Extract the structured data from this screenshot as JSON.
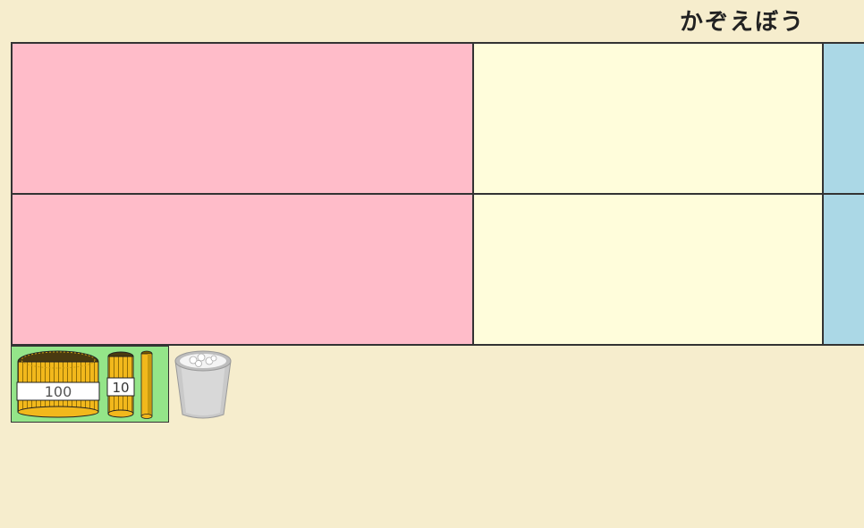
{
  "header": {
    "title": "かぞえぼう"
  },
  "board": {
    "rows": [
      {
        "columns": [
          "hundreds",
          "tens",
          "ones"
        ]
      },
      {
        "columns": [
          "hundreds",
          "tens",
          "ones"
        ]
      }
    ],
    "colors": {
      "hundreds": "#ffbcc9",
      "tens": "#fffddb",
      "ones": "#abd8e6"
    }
  },
  "toolbar": {
    "tools": [
      {
        "icon": "bundle-100-icon",
        "label": "100"
      },
      {
        "icon": "bundle-10-icon",
        "label": "10"
      },
      {
        "icon": "single-stick-icon"
      }
    ],
    "background": "#94e589"
  },
  "trash": {
    "icon": "trash-bin-icon"
  }
}
